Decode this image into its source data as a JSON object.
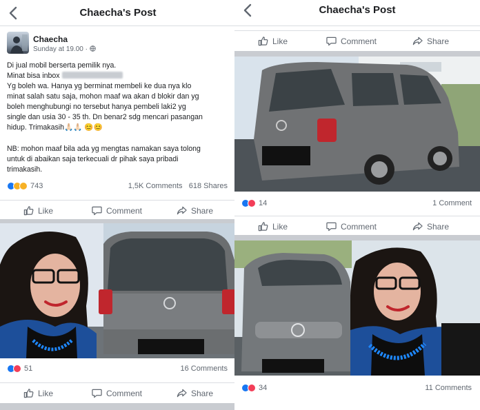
{
  "left": {
    "nav": {
      "title": "Chaecha's Post"
    },
    "post": {
      "author": "Chaecha",
      "time": "Sunday at 19.00 · ",
      "lines": [
        "Di jual mobil berserta pemilik nya.",
        "Minat bisa inbox ",
        "Yg boleh wa. Hanya yg berminat membeli ke dua nya klo",
        "minat salah satu saja, mohon maaf wa akan d blokir dan yg",
        "boleh menghubungi no tersebut hanya pembeli laki2 yg",
        "single dan usia 30 - 35 th. Dn benar2 sdg mencari pasangan",
        "hidup. Trimakasih🙏🏻🙏🏻 😊😊",
        "NB: mohon maaf bila ada yg mengtas namakan saya tolong",
        "untuk di abaikan saja terkecuali dr pihak saya pribadi",
        "trimakasih."
      ],
      "reaction_count": "743",
      "comments": "1,5K Comments",
      "shares": "618 Shares"
    },
    "photo1": {
      "reaction_count": "51",
      "comments": "16 Comments"
    }
  },
  "right": {
    "nav": {
      "title": "Chaecha's Post"
    },
    "photo_a": {
      "reaction_count": "14",
      "comments": "1 Comment"
    },
    "photo_b": {
      "reaction_count": "34",
      "comments": "11 Comments"
    }
  },
  "actions": {
    "like": "Like",
    "comment": "Comment",
    "share": "Share"
  },
  "colors": {
    "like_blue": "#1877f2",
    "love_red": "#f33e58",
    "haha_yellow": "#f7b125",
    "text": "#1c1e21",
    "muted": "#606770",
    "car_grey": "#6b6e70"
  },
  "icons": [
    "back-chevron-icon",
    "globe-icon",
    "thumbs-up-icon",
    "comment-bubble-icon",
    "share-arrow-icon"
  ]
}
